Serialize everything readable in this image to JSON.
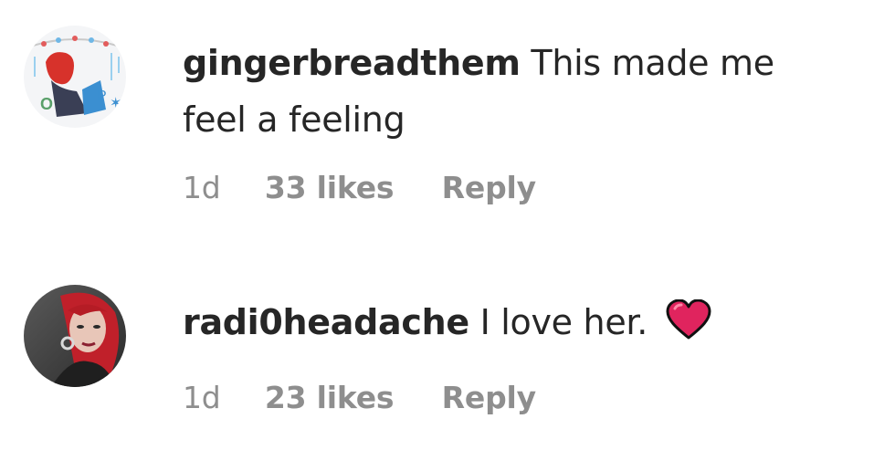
{
  "comments": [
    {
      "username": "gingerbreadthem",
      "text": "This made me feel a feeling",
      "time": "1d",
      "likes": "33 likes",
      "reply_label": "Reply",
      "avatar_icon": "avatar-drawing-red-hair"
    },
    {
      "username": "radi0headache",
      "text": "I love her.",
      "emoji": "red-heart-icon",
      "time": "1d",
      "likes": "23 likes",
      "reply_label": "Reply",
      "avatar_icon": "avatar-photo-red-hair"
    }
  ],
  "colors": {
    "text": "#262626",
    "meta": "#8e8e8e",
    "heart": "#e0245e"
  }
}
